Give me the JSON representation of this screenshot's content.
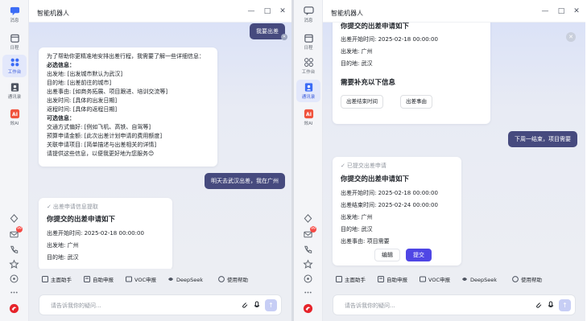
{
  "app": {
    "title": "智能机器人",
    "input_placeholder": "请告诉我你的疑问...",
    "accent_color": "#4f46e5",
    "user_bubble_color": "#464a7e"
  },
  "sidebar": {
    "items": [
      {
        "icon": "chat-icon",
        "label": "消息"
      },
      {
        "icon": "calendar-icon",
        "label": "日程"
      },
      {
        "icon": "workbench-icon",
        "label": "工作台"
      },
      {
        "icon": "contacts-icon",
        "label": "通讯录"
      },
      {
        "icon": "ai-icon",
        "label": "效AI",
        "badge_text": "AI"
      }
    ],
    "bottom_icons": [
      "cloud-icon",
      "mail-icon",
      "call-icon",
      "star-icon",
      "record-icon",
      "more-icon",
      "brand-logo-icon"
    ],
    "mail_badge": "99"
  },
  "toolbar": {
    "items": [
      {
        "icon": "assistant-icon",
        "label": "主面助手"
      },
      {
        "icon": "report-icon",
        "label": "自助申报"
      },
      {
        "icon": "voc-icon",
        "label": "VOC申报"
      },
      {
        "icon": "deepseek-icon",
        "label": "DeepSeek"
      },
      {
        "icon": "help-icon",
        "label": "使用帮助"
      }
    ]
  },
  "left": {
    "user_msg_1": "我要出差",
    "bot_msg_1": [
      "为了帮助你更精准地安排出差行程，我需要了解一些详细信息：",
      "必选信息：",
      "出发地: [出发城市默认为武汉]",
      "目的地: [出差前往的城市]",
      "出差事由: [如商务拓展、项目跟进、培训交流等]",
      "出发时间: [具体的出发日期]",
      "返程时间: [具体的返程日期]",
      "可选信息：",
      "交通方式偏好: [例如飞机、高铁、自驾等]",
      "预算申请金额: [此次出差计划申请的费用额度]",
      "关联申请项目: [简单描述与出差相关的详情]",
      "请提供这些信息，以便我更好地为您服务😊"
    ],
    "user_msg_2": "明天去武汉出差，我在广州",
    "extract_status": "出差申请信息提取",
    "extract_heading": "你提交的出差申请如下",
    "extract_lines": [
      "出差开始时间:  2025-02-18 00:00:00",
      "出发地:  广州",
      "目的地:  武汉"
    ]
  },
  "right": {
    "card1_heading": "你提交的出差申请如下",
    "card1_lines": [
      "出差开始时间:  2025-02-18 00:00:00",
      "出发地:  广州",
      "目的地:  武汉"
    ],
    "card1_need": "需要补充以下信息",
    "card1_chips": [
      "出差结束时间",
      "出差事由"
    ],
    "user_msg": "下周一结束，项目需要",
    "card2_status": "已提交出差申请",
    "card2_heading": "你提交的出差申请如下",
    "card2_lines": [
      "出差开始时间:  2025-02-18 00:00:00",
      "出差结束时间:  2025-02-24 00:00:00",
      "出发地:  广州",
      "目的地:  武汉",
      "出差事由:  项目需要"
    ],
    "edit_label": "编辑",
    "submit_label": "提交"
  }
}
